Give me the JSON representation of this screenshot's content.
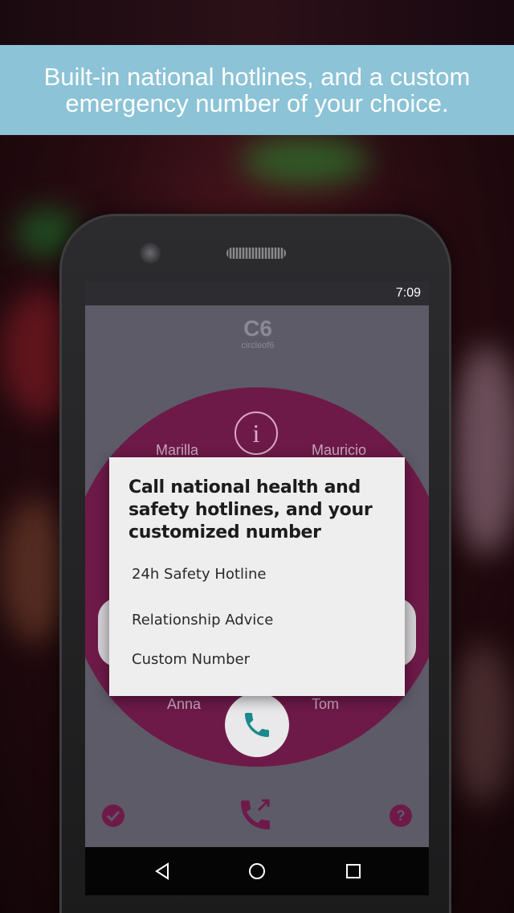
{
  "banner": {
    "text": "Built-in national hotlines, and a custom emergency number of your choice."
  },
  "statusbar": {
    "time": "7:09"
  },
  "app": {
    "logo_mark": "C6",
    "logo_text": "circleof6"
  },
  "circle": {
    "info_symbol": "i",
    "contacts": [
      "Marilla",
      "Mauricio",
      "Anna",
      "Tom"
    ]
  },
  "dialog": {
    "title": "Call national health and safety hotlines, and your customized number",
    "options": [
      "24h Safety Hotline",
      "Relationship Advice",
      "Custom Number"
    ]
  },
  "colors": {
    "banner": "#8cc3d6",
    "circle": "#6e1a49",
    "screen": "#5d5b68",
    "accent": "#1a8a8c"
  },
  "icons": {
    "check": "check-icon",
    "outgoing_call": "outgoing-call-icon",
    "help": "help-icon",
    "back": "back-icon",
    "home": "home-icon",
    "recents": "recents-icon"
  }
}
